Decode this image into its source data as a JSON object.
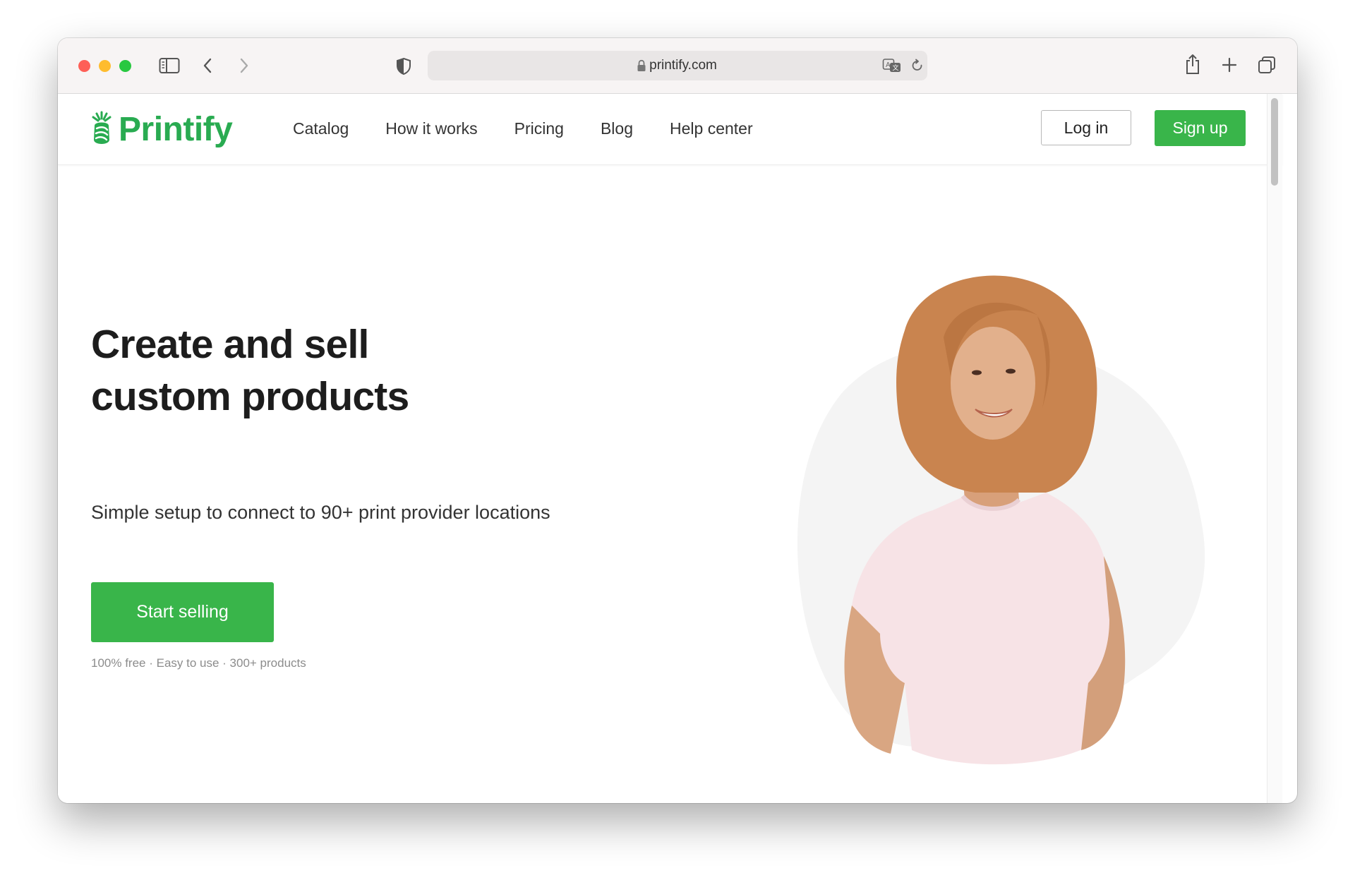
{
  "browser": {
    "url": "printify.com"
  },
  "site": {
    "logo_text": "Printify",
    "brand_color": "#39b54a",
    "nav": [
      {
        "label": "Catalog"
      },
      {
        "label": "How it works"
      },
      {
        "label": "Pricing"
      },
      {
        "label": "Blog"
      },
      {
        "label": "Help center"
      }
    ],
    "login_label": "Log in",
    "signup_label": "Sign up"
  },
  "hero": {
    "title_line1": "Create and sell",
    "title_line2": "custom products",
    "subtitle": "Simple setup to connect to 90+ print provider locations",
    "cta_label": "Start selling",
    "perks": "100% free · Easy to use  · 300+ products"
  }
}
